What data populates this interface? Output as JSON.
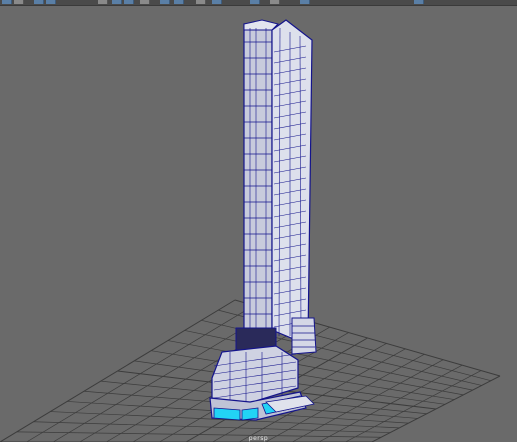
{
  "viewport": {
    "camera_label": "persp",
    "background_color": "#6a6a6a",
    "grid_color": "#3c3c3c",
    "wire_color": "#14148c",
    "surface_color": "#d9dbe8",
    "selection_color": "#22d3f5"
  },
  "toolbar": {
    "icons": [
      "select-icon",
      "move-icon",
      "rotate-icon",
      "scale-icon",
      "snap-grid-icon",
      "snap-curve-icon",
      "snap-point-icon",
      "camera-icon",
      "wireframe-icon",
      "shaded-icon",
      "textured-icon",
      "lighting-icon",
      "shadow-icon",
      "isolate-icon",
      "xray-icon",
      "grid-toggle-icon"
    ]
  }
}
